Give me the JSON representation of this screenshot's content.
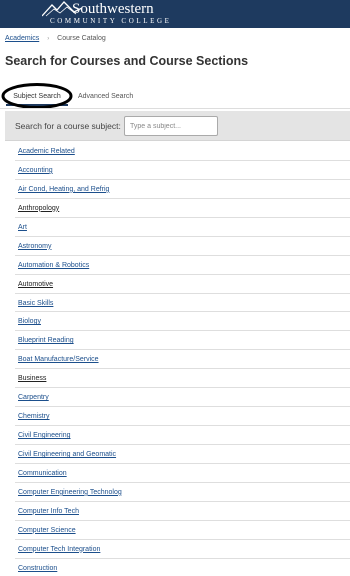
{
  "header": {
    "logo_title": "Southwestern",
    "logo_subtitle": "COMMUNITY COLLEGE",
    "background": "#1e3a5f"
  },
  "breadcrumb": {
    "link": "Academics",
    "separator": "›",
    "current": "Course Catalog"
  },
  "page_title": "Search for Courses and Course Sections",
  "tabs": [
    {
      "label": "Subject Search",
      "active": true,
      "annotation": "circled"
    },
    {
      "label": "Advanced Search",
      "active": false
    }
  ],
  "search": {
    "label": "Search for a course subject:",
    "placeholder": "Type a subject...",
    "value": ""
  },
  "subjects": [
    {
      "label": "Academic Related",
      "color": "#1c4f8c"
    },
    {
      "label": "Accounting",
      "color": "#1c4f8c"
    },
    {
      "label": "Air Cond, Heating, and Refrig",
      "color": "#1c4f8c"
    },
    {
      "label": "Anthropology",
      "color": "#222222"
    },
    {
      "label": "Art",
      "color": "#1c4f8c"
    },
    {
      "label": "Astronomy",
      "color": "#1c4f8c"
    },
    {
      "label": "Automation & Robotics",
      "color": "#1c4f8c"
    },
    {
      "label": "Automotive",
      "color": "#222222"
    },
    {
      "label": "Basic Skills",
      "color": "#1c4f8c"
    },
    {
      "label": "Biology",
      "color": "#1c4f8c"
    },
    {
      "label": "Blueprint Reading",
      "color": "#1c4f8c"
    },
    {
      "label": "Boat Manufacture/Service",
      "color": "#1c4f8c"
    },
    {
      "label": "Business",
      "color": "#222222"
    },
    {
      "label": "Carpentry",
      "color": "#1c4f8c"
    },
    {
      "label": "Chemistry",
      "color": "#1c4f8c"
    },
    {
      "label": "Civil Engineering",
      "color": "#1c4f8c"
    },
    {
      "label": "Civil Engineering and Geomatic",
      "color": "#1c4f8c"
    },
    {
      "label": "Communication",
      "color": "#1c4f8c"
    },
    {
      "label": "Computer Engineering Technolog",
      "color": "#1c4f8c"
    },
    {
      "label": "Computer Info Tech",
      "color": "#1c4f8c"
    },
    {
      "label": "Computer Science",
      "color": "#1c4f8c"
    },
    {
      "label": "Computer Tech Integration",
      "color": "#1c4f8c"
    },
    {
      "label": "Construction",
      "color": "#1c4f8c"
    }
  ],
  "colors": {
    "link": "#1c4f8c",
    "search_bar_bg": "#e4e4e4"
  }
}
